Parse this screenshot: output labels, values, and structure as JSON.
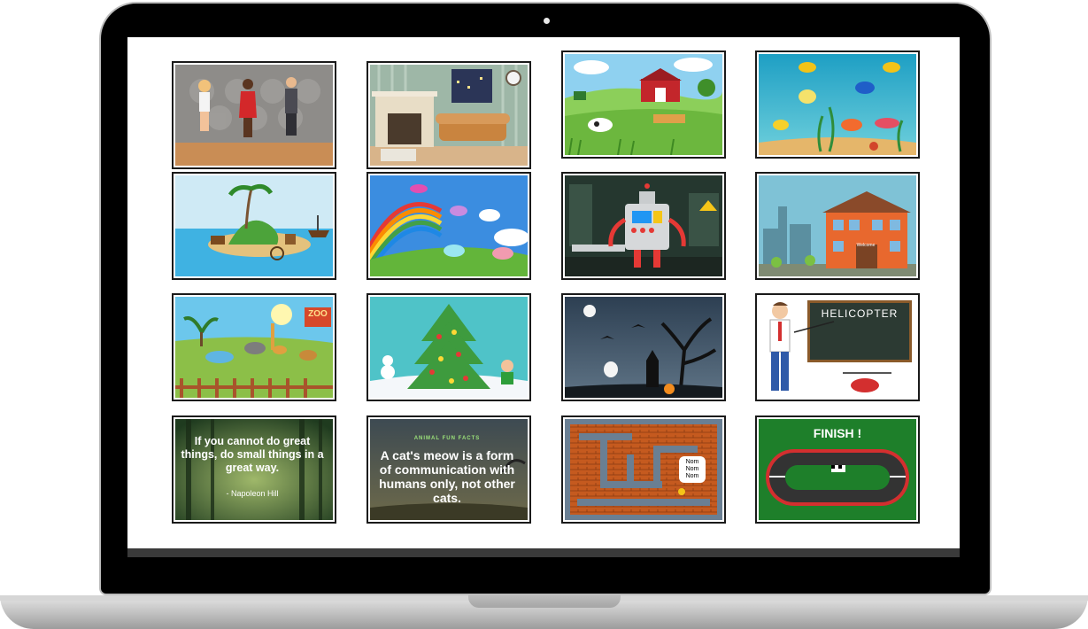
{
  "thumbnails": [
    {
      "name": "characters-scene"
    },
    {
      "name": "living-room-scene"
    },
    {
      "name": "farm-scene"
    },
    {
      "name": "underwater-scene"
    },
    {
      "name": "pirate-island-scene"
    },
    {
      "name": "unicorn-rainbow-scene"
    },
    {
      "name": "robot-factory-scene"
    },
    {
      "name": "town-building-scene",
      "sign": "Welcome"
    },
    {
      "name": "zoo-scene",
      "sign": "ZOO"
    },
    {
      "name": "christmas-tree-scene"
    },
    {
      "name": "halloween-scene"
    },
    {
      "name": "teacher-board-scene",
      "board": "HELICOPTER"
    },
    {
      "name": "quote-scene",
      "quote": "If you cannot do great things, do small things in a great way.",
      "author": "- Napoleon Hill"
    },
    {
      "name": "cat-fact-scene",
      "header": "ANIMAL FUN FACTS",
      "fact": "A cat's meow is a form of communication with humans only, not other cats."
    },
    {
      "name": "maze-game-scene",
      "bubble": [
        "Nom",
        "Nom",
        "Nom"
      ]
    },
    {
      "name": "race-track-scene",
      "banner": "FINISH !"
    }
  ],
  "colors": {
    "bezel": "#000000",
    "screen": "#ffffff",
    "frame": "#1a1a1a"
  }
}
